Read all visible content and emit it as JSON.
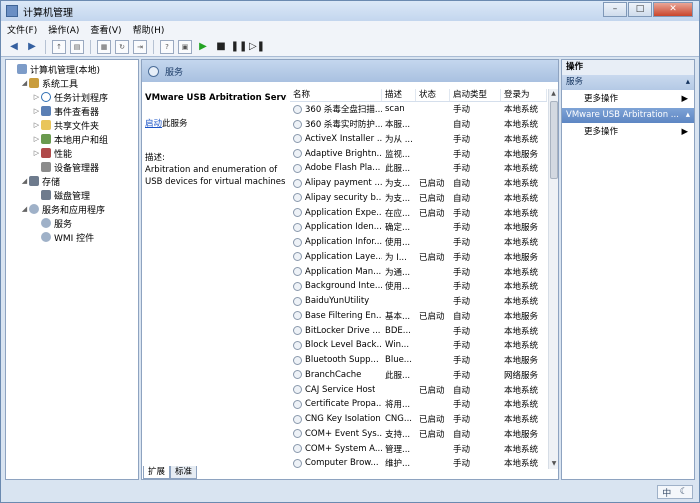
{
  "window": {
    "title": "计算机管理"
  },
  "window_buttons": {
    "minimize": "–",
    "maximize": "□",
    "close": "✕"
  },
  "menu": [
    "文件(F)",
    "操作(A)",
    "查看(V)",
    "帮助(H)"
  ],
  "tree": [
    {
      "label": "计算机管理(本地)",
      "level": 0,
      "twisty": "",
      "icon": "comp"
    },
    {
      "label": "系统工具",
      "level": 1,
      "twisty": "◢",
      "icon": "tools"
    },
    {
      "label": "任务计划程序",
      "level": 2,
      "twisty": "▷",
      "icon": "clock"
    },
    {
      "label": "事件查看器",
      "level": 2,
      "twisty": "▷",
      "icon": "event"
    },
    {
      "label": "共享文件夹",
      "level": 2,
      "twisty": "▷",
      "icon": "folder"
    },
    {
      "label": "本地用户和组",
      "level": 2,
      "twisty": "▷",
      "icon": "users"
    },
    {
      "label": "性能",
      "level": 2,
      "twisty": "▷",
      "icon": "perf"
    },
    {
      "label": "设备管理器",
      "level": 2,
      "twisty": "",
      "icon": "dev"
    },
    {
      "label": "存储",
      "level": 1,
      "twisty": "◢",
      "icon": "disk"
    },
    {
      "label": "磁盘管理",
      "level": 2,
      "twisty": "",
      "icon": "disk"
    },
    {
      "label": "服务和应用程序",
      "level": 1,
      "twisty": "◢",
      "icon": "svc"
    },
    {
      "label": "服务",
      "level": 2,
      "twisty": "",
      "icon": "svc"
    },
    {
      "label": "WMI 控件",
      "level": 2,
      "twisty": "",
      "icon": "svc"
    }
  ],
  "services_header": "服务",
  "selected_service": {
    "name": "VMware USB Arbitration Service",
    "start_link": "启动",
    "start_suffix": "此服务",
    "desc_label": "描述:",
    "description": "Arbitration and enumeration of USB devices for virtual machines"
  },
  "columns": [
    "名称",
    "描述",
    "状态",
    "启动类型",
    "登录为"
  ],
  "rows": [
    [
      "360 杀毒全盘扫描...",
      "scan",
      "",
      "手动",
      "本地系统"
    ],
    [
      "360 杀毒实时防护...",
      "本服...",
      "",
      "自动",
      "本地系统"
    ],
    [
      "ActiveX Installer ...",
      "为从 ...",
      "",
      "手动",
      "本地系统"
    ],
    [
      "Adaptive Brightn...",
      "监视...",
      "",
      "手动",
      "本地服务"
    ],
    [
      "Adobe Flash Pla...",
      "此服...",
      "",
      "手动",
      "本地系统"
    ],
    [
      "Alipay payment ...",
      "为支...",
      "已启动",
      "自动",
      "本地系统"
    ],
    [
      "Alipay security b...",
      "为支...",
      "已启动",
      "自动",
      "本地系统"
    ],
    [
      "Application Expe...",
      "在应...",
      "已启动",
      "手动",
      "本地系统"
    ],
    [
      "Application Iden...",
      "确定...",
      "",
      "手动",
      "本地服务"
    ],
    [
      "Application Infor...",
      "使用...",
      "",
      "手动",
      "本地系统"
    ],
    [
      "Application Laye...",
      "为 I...",
      "已启动",
      "手动",
      "本地服务"
    ],
    [
      "Application Man...",
      "为通...",
      "",
      "手动",
      "本地系统"
    ],
    [
      "Background Inte...",
      "使用...",
      "",
      "手动",
      "本地系统"
    ],
    [
      "BaiduYunUtility",
      "",
      "",
      "手动",
      "本地系统"
    ],
    [
      "Base Filtering En...",
      "基本...",
      "已启动",
      "自动",
      "本地服务"
    ],
    [
      "BitLocker Drive ...",
      "BDE...",
      "",
      "手动",
      "本地系统"
    ],
    [
      "Block Level Back...",
      "Win...",
      "",
      "手动",
      "本地系统"
    ],
    [
      "Bluetooth Supp...",
      "Blue...",
      "",
      "手动",
      "本地服务"
    ],
    [
      "BranchCache",
      "此服...",
      "",
      "手动",
      "网络服务"
    ],
    [
      "CAJ Service Host",
      "",
      "已启动",
      "自动",
      "本地系统"
    ],
    [
      "Certificate Propa...",
      "将用...",
      "",
      "手动",
      "本地系统"
    ],
    [
      "CNG Key Isolation",
      "CNG...",
      "已启动",
      "手动",
      "本地系统"
    ],
    [
      "COM+ Event Sys...",
      "支持...",
      "已启动",
      "自动",
      "本地服务"
    ],
    [
      "COM+ System A...",
      "管理...",
      "",
      "手动",
      "本地系统"
    ],
    [
      "Computer Brow...",
      "维护...",
      "",
      "手动",
      "本地系统"
    ]
  ],
  "tabs": [
    "扩展",
    "标准"
  ],
  "actions": {
    "title": "操作",
    "section1": "服务",
    "more1": "更多操作",
    "section2": "VMware USB Arbitration ...",
    "more2": "更多操作"
  },
  "ime": {
    "lang": "中",
    "mode": "☾"
  }
}
